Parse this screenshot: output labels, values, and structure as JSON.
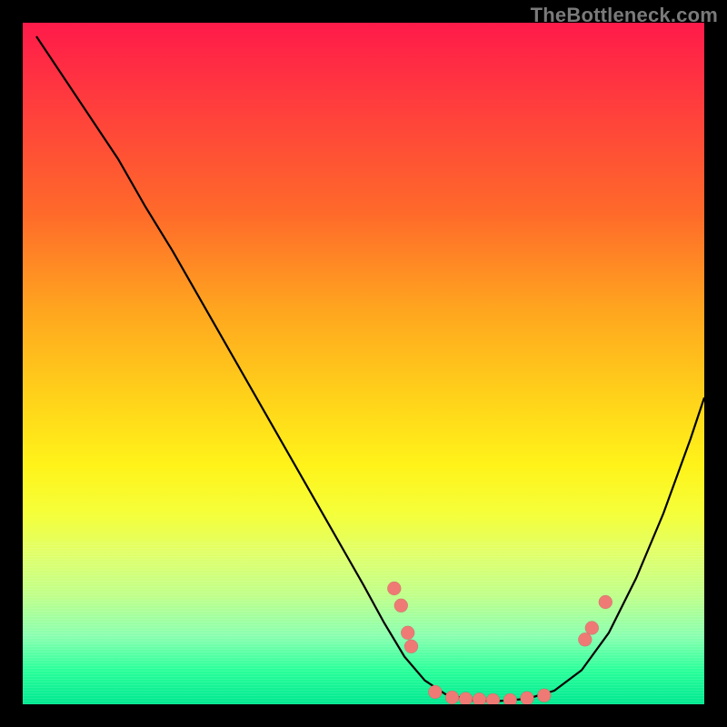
{
  "watermark": "TheBottleneck.com",
  "colors": {
    "curve": "#000000",
    "point_fill": "#ef7a75",
    "bg_black": "#000000"
  },
  "chart_data": {
    "type": "line",
    "title": "",
    "xlabel": "",
    "ylabel": "",
    "xlim": [
      0,
      100
    ],
    "ylim": [
      0,
      100
    ],
    "curve": [
      {
        "x": 2.0,
        "y": 98.0
      },
      {
        "x": 6.0,
        "y": 92.0
      },
      {
        "x": 10.0,
        "y": 86.0
      },
      {
        "x": 14.0,
        "y": 80.0
      },
      {
        "x": 18.0,
        "y": 73.0
      },
      {
        "x": 22.0,
        "y": 66.5
      },
      {
        "x": 26.0,
        "y": 59.5
      },
      {
        "x": 30.0,
        "y": 52.5
      },
      {
        "x": 34.0,
        "y": 45.5
      },
      {
        "x": 38.0,
        "y": 38.5
      },
      {
        "x": 42.0,
        "y": 31.5
      },
      {
        "x": 46.0,
        "y": 24.5
      },
      {
        "x": 50.0,
        "y": 17.5
      },
      {
        "x": 53.0,
        "y": 12.0
      },
      {
        "x": 56.0,
        "y": 7.0
      },
      {
        "x": 59.0,
        "y": 3.5
      },
      {
        "x": 62.0,
        "y": 1.5
      },
      {
        "x": 66.0,
        "y": 0.6
      },
      {
        "x": 70.0,
        "y": 0.5
      },
      {
        "x": 74.0,
        "y": 0.8
      },
      {
        "x": 78.0,
        "y": 2.0
      },
      {
        "x": 82.0,
        "y": 5.0
      },
      {
        "x": 86.0,
        "y": 10.5
      },
      {
        "x": 90.0,
        "y": 18.5
      },
      {
        "x": 94.0,
        "y": 28.0
      },
      {
        "x": 98.0,
        "y": 39.0
      },
      {
        "x": 100.0,
        "y": 45.0
      }
    ],
    "points": [
      {
        "x": 54.5,
        "y": 17.0
      },
      {
        "x": 55.5,
        "y": 14.5
      },
      {
        "x": 56.5,
        "y": 10.5
      },
      {
        "x": 57.0,
        "y": 8.5
      },
      {
        "x": 60.5,
        "y": 1.8
      },
      {
        "x": 63.0,
        "y": 1.0
      },
      {
        "x": 65.0,
        "y": 0.8
      },
      {
        "x": 67.0,
        "y": 0.7
      },
      {
        "x": 69.0,
        "y": 0.6
      },
      {
        "x": 71.5,
        "y": 0.6
      },
      {
        "x": 74.0,
        "y": 0.9
      },
      {
        "x": 76.5,
        "y": 1.3
      },
      {
        "x": 82.5,
        "y": 9.5
      },
      {
        "x": 83.5,
        "y": 11.2
      },
      {
        "x": 85.5,
        "y": 15.0
      }
    ]
  }
}
